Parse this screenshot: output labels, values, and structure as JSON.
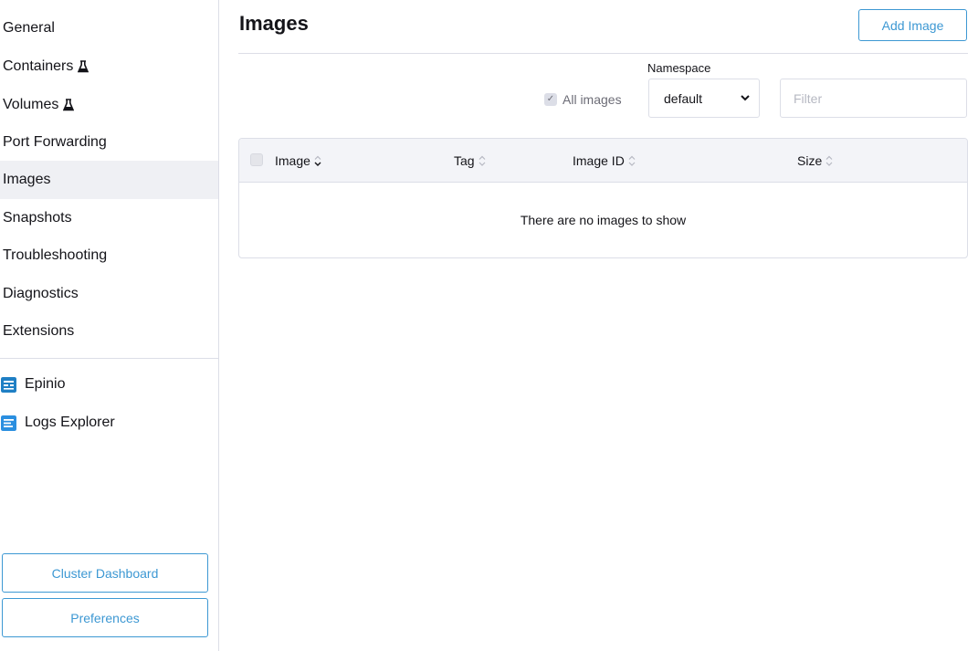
{
  "sidebar": {
    "items": [
      {
        "label": "General"
      },
      {
        "label": "Containers"
      },
      {
        "label": "Volumes"
      },
      {
        "label": "Port Forwarding"
      },
      {
        "label": "Images"
      },
      {
        "label": "Snapshots"
      },
      {
        "label": "Troubleshooting"
      },
      {
        "label": "Diagnostics"
      },
      {
        "label": "Extensions"
      }
    ],
    "extensions": [
      {
        "label": "Epinio",
        "icon": "epinio-icon"
      },
      {
        "label": "Logs Explorer",
        "icon": "logs-explorer-icon"
      }
    ],
    "buttons": {
      "cluster_dashboard": "Cluster Dashboard",
      "preferences": "Preferences"
    }
  },
  "main": {
    "title": "Images",
    "add_button": "Add Image",
    "all_images_label": "All images",
    "all_images_checked": true,
    "namespace_label": "Namespace",
    "namespace_value": "default",
    "filter_placeholder": "Filter",
    "table": {
      "columns": [
        "Image",
        "Tag",
        "Image ID",
        "Size"
      ],
      "empty_message": "There are no images to show"
    }
  },
  "colors": {
    "accent": "#3d98d3",
    "border": "#dcdee7",
    "active_bg": "#eff0f4",
    "header_bg": "#f3f4f8"
  }
}
